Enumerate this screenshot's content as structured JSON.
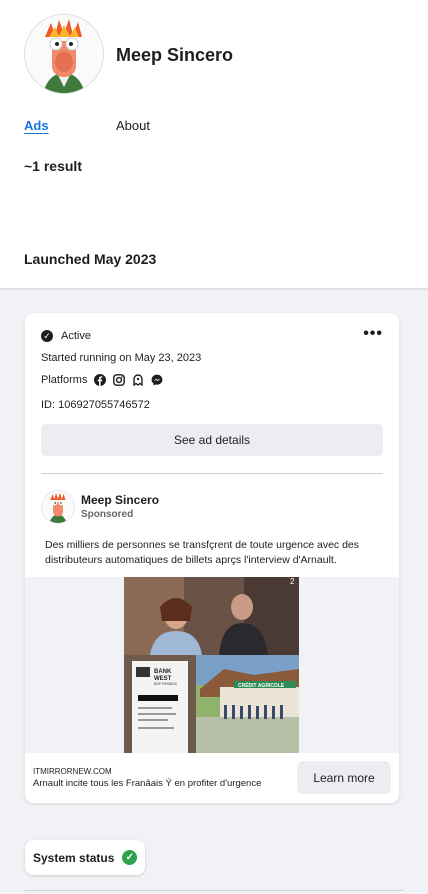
{
  "page": {
    "name": "Meep Sincero",
    "tabs": [
      {
        "label": "Ads",
        "active": true
      },
      {
        "label": "About",
        "active": false
      }
    ],
    "result_count": "~1 result",
    "launched": "Launched May 2023"
  },
  "ad": {
    "status": "Active",
    "started": "Started running on May 23, 2023",
    "platforms_label": "Platforms",
    "platform_icons": [
      "facebook-icon",
      "instagram-icon",
      "audience-network-icon",
      "messenger-icon"
    ],
    "id": "ID: 106927055746572",
    "details_label": "See ad details",
    "advertiser": "Meep Sincero",
    "sponsored": "Sponsored",
    "body": "Des milliers de personnes se transfçrent de toute urgence avec des distributeurs automatiques de billets aprçs l'interview d'Arnault.",
    "collage": {
      "top_number": "2",
      "bank_line1": "BANK",
      "bank_line2": "WEST",
      "bank_sub": "BNP PARIBAS",
      "branch_sign": "CRÉDIT AGRICOLE"
    },
    "link_domain": "ITMIRRORNEW.COM",
    "link_title": "Arnault incite tous les Franâais Ý en profiter d'urgence",
    "cta": "Learn more"
  },
  "system_status": {
    "label": "System status",
    "state": "ok"
  },
  "colors": {
    "accent": "#1b74e4",
    "ok": "#31a24c",
    "background": "#f0f2f5"
  }
}
